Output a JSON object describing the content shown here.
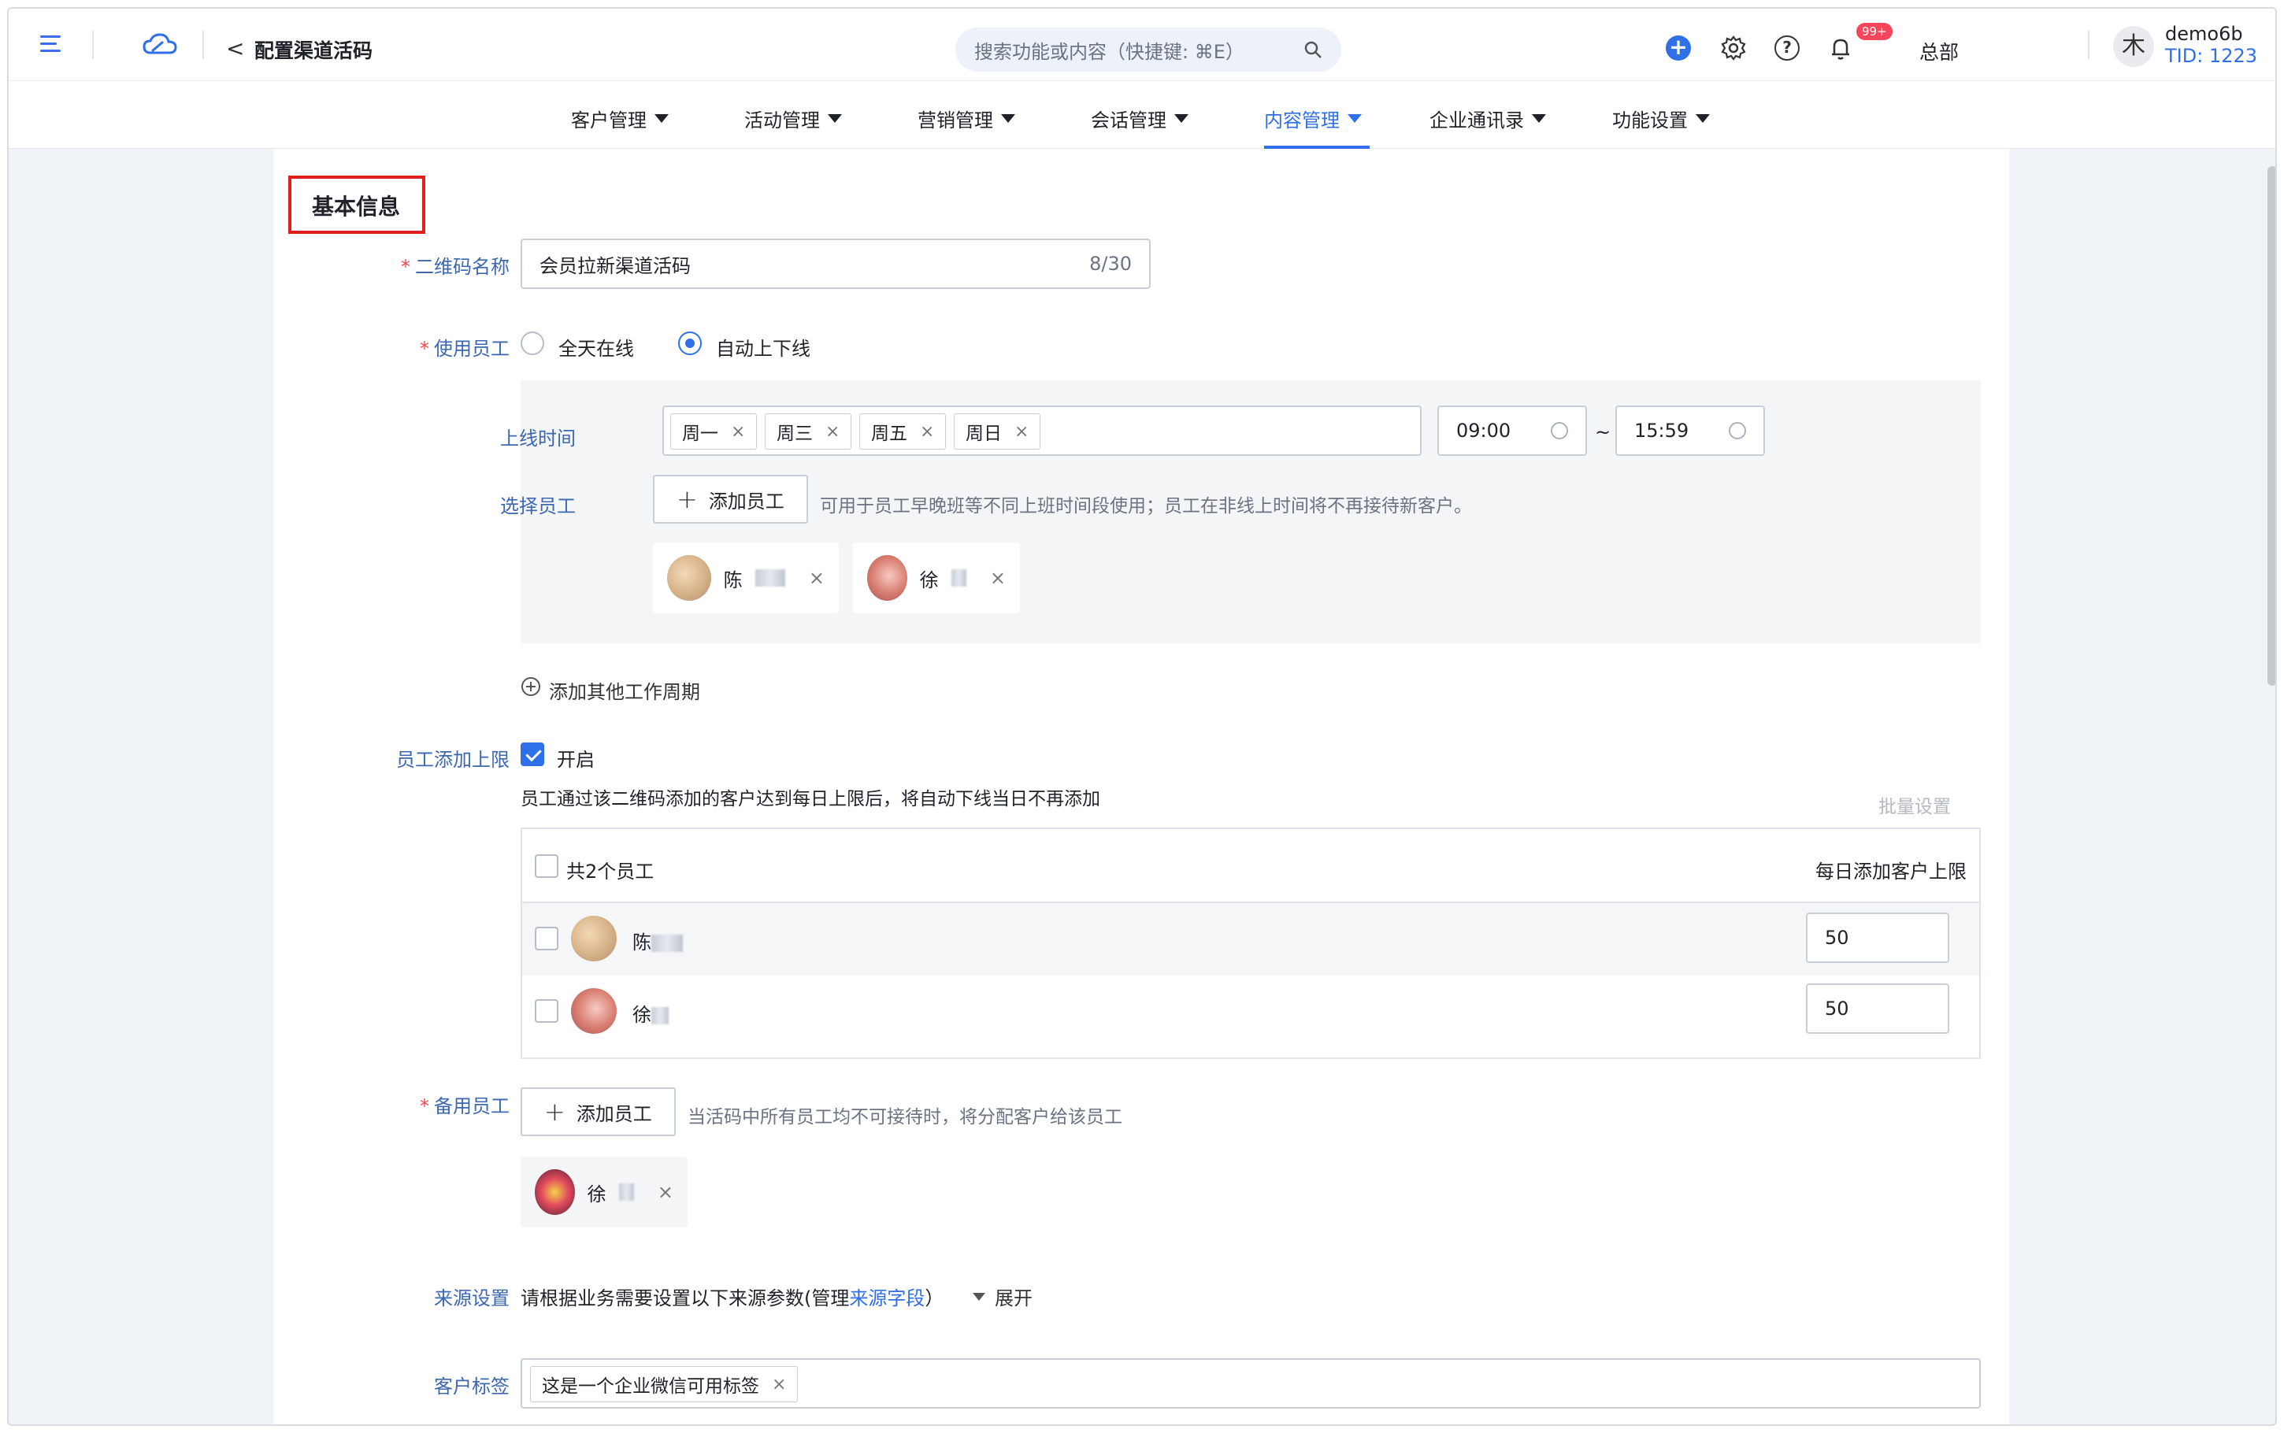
{
  "header": {
    "page_title": "配置渠道活码",
    "search_placeholder": "搜索功能或内容（快捷键: ⌘E）",
    "badge": "99+",
    "org": "总部",
    "avatar_char": "木",
    "user_name": "demo6b",
    "tid": "TID: 1223",
    "icons": [
      "menu-icon",
      "cloud-logo-icon",
      "back-icon",
      "search-icon",
      "add-icon",
      "gear-icon",
      "help-icon",
      "bell-icon"
    ]
  },
  "nav": {
    "items": [
      {
        "label": "客户管理"
      },
      {
        "label": "活动管理"
      },
      {
        "label": "营销管理"
      },
      {
        "label": "会话管理"
      },
      {
        "label": "内容管理"
      },
      {
        "label": "企业通讯录"
      },
      {
        "label": "功能设置"
      }
    ],
    "active": "内容管理"
  },
  "form": {
    "section_title": "基本信息",
    "qrcode_name": {
      "label": "二维码名称",
      "value": "会员拉新渠道活码",
      "counter": "8/30"
    },
    "staff_mode": {
      "label": "使用员工",
      "options": [
        "全天在线",
        "自动上下线"
      ],
      "selected": "自动上下线"
    },
    "online_time": {
      "label": "上线时间",
      "days": [
        "周一",
        "周三",
        "周五",
        "周日"
      ],
      "start": "09:00",
      "separator": "~",
      "end": "15:59"
    },
    "select_staff": {
      "label": "选择员工",
      "button": "添加员工",
      "hint": "可用于员工早晚班等不同上班时间段使用；员工在非线上时间将不再接待新客户。",
      "staff": [
        {
          "name": "陈"
        },
        {
          "name": "徐"
        }
      ]
    },
    "add_period": "添加其他工作周期",
    "limit": {
      "label": "员工添加上限",
      "checkbox_label": "开启",
      "checked": true,
      "desc": "员工通过该二维码添加的客户达到每日上限后，将自动下线当日不再添加",
      "batch": "批量设置",
      "table": {
        "header_total": "共2个员工",
        "header_limit": "每日添加客户上限",
        "rows": [
          {
            "name": "陈",
            "limit": "50"
          },
          {
            "name": "徐",
            "limit": "50"
          }
        ]
      }
    },
    "backup": {
      "label": "备用员工",
      "button": "添加员工",
      "hint": "当活码中所有员工均不可接待时，将分配客户给该员工",
      "staff": [
        {
          "name": "徐"
        }
      ]
    },
    "source": {
      "label": "来源设置",
      "text_before": "请根据业务需要设置以下来源参数(管理",
      "link": "来源字段",
      "text_after": "）",
      "expand": "展开"
    },
    "tags": {
      "label": "客户标签",
      "values": [
        "这是一个企业微信可用标签"
      ]
    }
  },
  "colors": {
    "accent": "#2f6fe8",
    "required": "#f04848",
    "highlight_box": "#e01e1e",
    "label": "#3d67b0"
  }
}
